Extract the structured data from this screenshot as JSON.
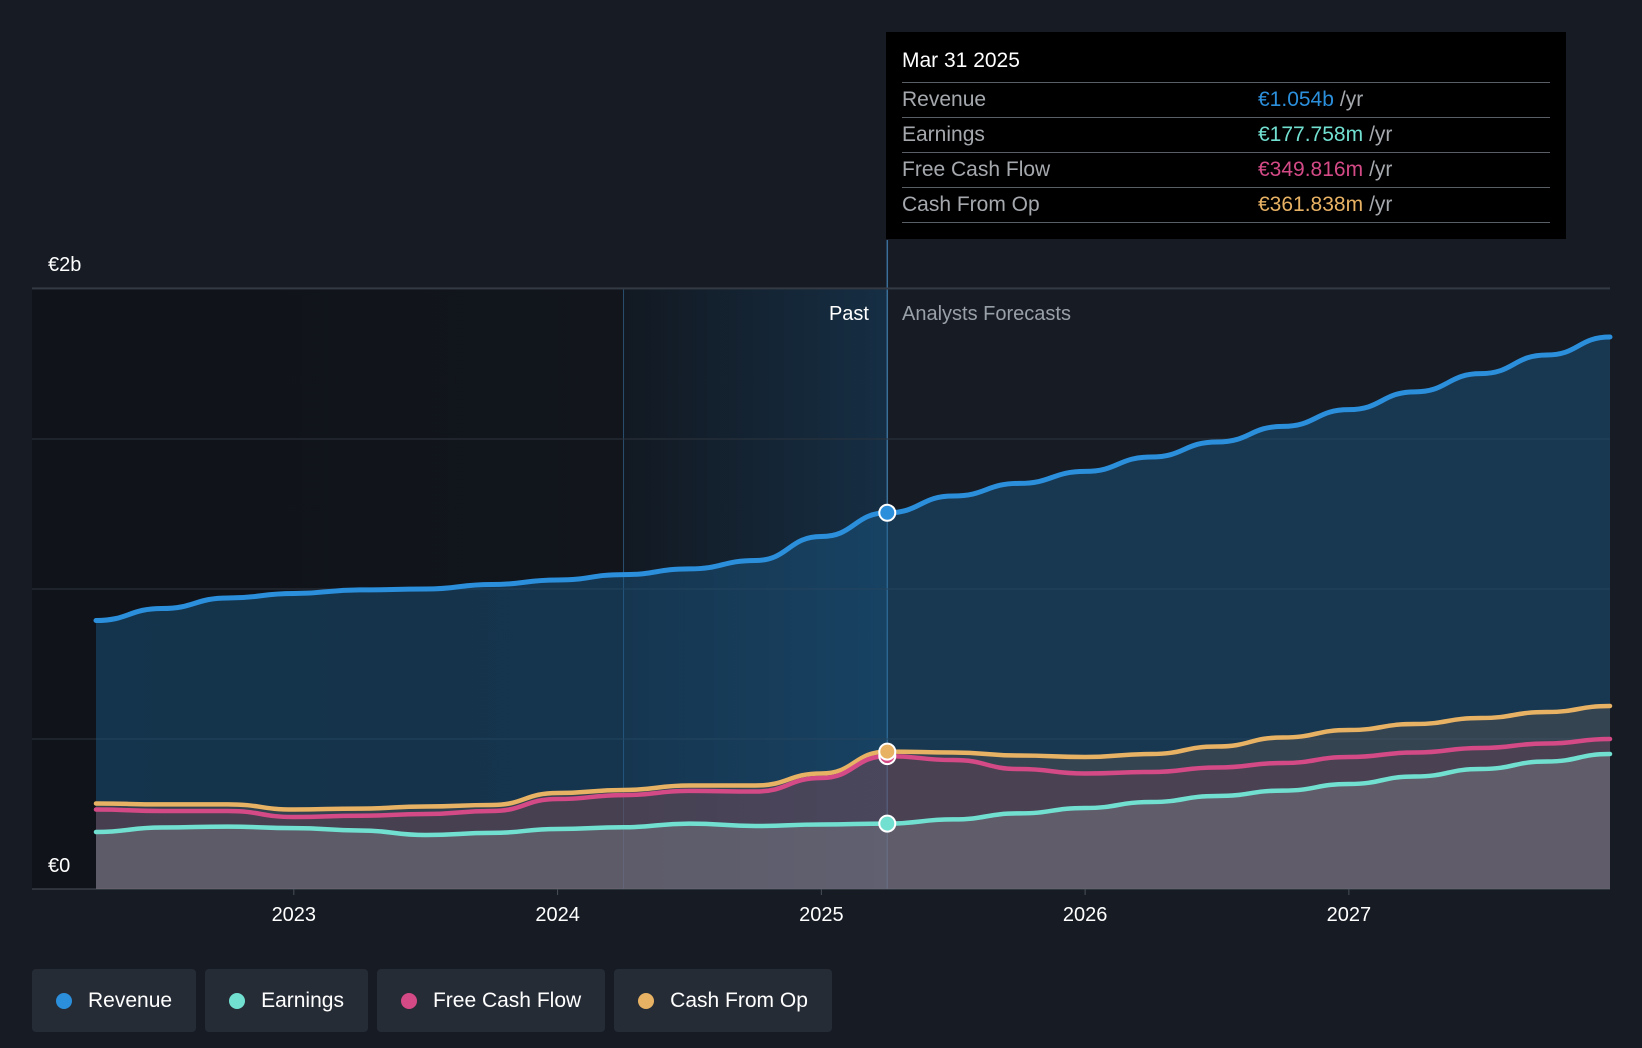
{
  "chart_data": {
    "type": "area",
    "y_axis": {
      "ticks": [
        "€0",
        "€2b"
      ],
      "ylim": [
        0,
        2
      ]
    },
    "x_axis": {
      "ticks": [
        2023,
        2024,
        2025,
        2026,
        2027
      ],
      "xlim": [
        2022.25,
        2027.99
      ]
    },
    "past_label": "Past",
    "forecast_label": "Analysts Forecasts",
    "divider_x": 2025.25,
    "highlight_start_x": 2024.25,
    "grid": true,
    "series": [
      {
        "name": "Revenue",
        "color": "#2b8fdc",
        "points": [
          [
            2022.25,
            0.895
          ],
          [
            2022.5,
            0.935
          ],
          [
            2022.75,
            0.97
          ],
          [
            2023.0,
            0.985
          ],
          [
            2023.25,
            0.997
          ],
          [
            2023.5,
            1.0
          ],
          [
            2023.75,
            1.015
          ],
          [
            2024.0,
            1.03
          ],
          [
            2024.25,
            1.048
          ],
          [
            2024.5,
            1.067
          ],
          [
            2024.75,
            1.095
          ],
          [
            2025.0,
            1.175
          ],
          [
            2025.25,
            1.254
          ],
          [
            2025.5,
            1.31
          ],
          [
            2025.75,
            1.352
          ],
          [
            2026.0,
            1.392
          ],
          [
            2026.25,
            1.44
          ],
          [
            2026.5,
            1.49
          ],
          [
            2026.75,
            1.542
          ],
          [
            2027.0,
            1.598
          ],
          [
            2027.25,
            1.657
          ],
          [
            2027.5,
            1.718
          ],
          [
            2027.75,
            1.78
          ],
          [
            2027.99,
            1.84
          ]
        ]
      },
      {
        "name": "Earnings",
        "color": "#72e0d1",
        "points": [
          [
            2022.25,
            0.19
          ],
          [
            2022.5,
            0.205
          ],
          [
            2022.75,
            0.208
          ],
          [
            2023.0,
            0.203
          ],
          [
            2023.25,
            0.195
          ],
          [
            2023.5,
            0.18
          ],
          [
            2023.75,
            0.187
          ],
          [
            2024.0,
            0.2
          ],
          [
            2024.25,
            0.206
          ],
          [
            2024.5,
            0.218
          ],
          [
            2024.75,
            0.21
          ],
          [
            2025.0,
            0.215
          ],
          [
            2025.25,
            0.218
          ],
          [
            2025.5,
            0.232
          ],
          [
            2025.75,
            0.252
          ],
          [
            2026.0,
            0.27
          ],
          [
            2026.25,
            0.29
          ],
          [
            2026.5,
            0.31
          ],
          [
            2026.75,
            0.328
          ],
          [
            2027.0,
            0.35
          ],
          [
            2027.25,
            0.375
          ],
          [
            2027.5,
            0.4
          ],
          [
            2027.75,
            0.425
          ],
          [
            2027.99,
            0.45
          ]
        ]
      },
      {
        "name": "Free Cash Flow",
        "color": "#d44a86",
        "points": [
          [
            2022.25,
            0.265
          ],
          [
            2022.5,
            0.26
          ],
          [
            2022.75,
            0.26
          ],
          [
            2023.0,
            0.24
          ],
          [
            2023.25,
            0.244
          ],
          [
            2023.5,
            0.25
          ],
          [
            2023.75,
            0.26
          ],
          [
            2024.0,
            0.3
          ],
          [
            2024.25,
            0.313
          ],
          [
            2024.5,
            0.327
          ],
          [
            2024.75,
            0.325
          ],
          [
            2025.0,
            0.37
          ],
          [
            2025.25,
            0.443
          ],
          [
            2025.5,
            0.43
          ],
          [
            2025.75,
            0.4
          ],
          [
            2026.0,
            0.385
          ],
          [
            2026.25,
            0.39
          ],
          [
            2026.5,
            0.405
          ],
          [
            2026.75,
            0.42
          ],
          [
            2027.0,
            0.44
          ],
          [
            2027.25,
            0.455
          ],
          [
            2027.5,
            0.47
          ],
          [
            2027.75,
            0.485
          ],
          [
            2027.99,
            0.5
          ]
        ]
      },
      {
        "name": "Cash From Op",
        "color": "#e8b264",
        "points": [
          [
            2022.25,
            0.285
          ],
          [
            2022.5,
            0.282
          ],
          [
            2022.75,
            0.282
          ],
          [
            2023.0,
            0.265
          ],
          [
            2023.25,
            0.268
          ],
          [
            2023.5,
            0.275
          ],
          [
            2023.75,
            0.28
          ],
          [
            2024.0,
            0.32
          ],
          [
            2024.25,
            0.33
          ],
          [
            2024.5,
            0.345
          ],
          [
            2024.75,
            0.345
          ],
          [
            2025.0,
            0.385
          ],
          [
            2025.25,
            0.458
          ],
          [
            2025.5,
            0.455
          ],
          [
            2025.75,
            0.445
          ],
          [
            2026.0,
            0.44
          ],
          [
            2026.25,
            0.45
          ],
          [
            2026.5,
            0.475
          ],
          [
            2026.75,
            0.505
          ],
          [
            2027.0,
            0.53
          ],
          [
            2027.25,
            0.55
          ],
          [
            2027.5,
            0.57
          ],
          [
            2027.75,
            0.59
          ],
          [
            2027.99,
            0.61
          ]
        ]
      }
    ],
    "markers": [
      {
        "series": "Revenue",
        "x": 2025.25,
        "y": 1.254
      },
      {
        "series": "Free Cash Flow",
        "x": 2025.25,
        "y": 0.443
      },
      {
        "series": "Cash From Op",
        "x": 2025.25,
        "y": 0.458
      },
      {
        "series": "Earnings",
        "x": 2025.25,
        "y": 0.218
      }
    ]
  },
  "tooltip": {
    "title": "Mar 31 2025",
    "rows": [
      {
        "label": "Revenue",
        "value": "€1.054b",
        "unit": "/yr",
        "color": "#2b8fdc"
      },
      {
        "label": "Earnings",
        "value": "€177.758m",
        "unit": "/yr",
        "color": "#72e0d1"
      },
      {
        "label": "Free Cash Flow",
        "value": "€349.816m",
        "unit": "/yr",
        "color": "#d44a86"
      },
      {
        "label": "Cash From Op",
        "value": "€361.838m",
        "unit": "/yr",
        "color": "#e8b264"
      }
    ]
  },
  "legend": {
    "items": [
      {
        "label": "Revenue",
        "color": "#2b8fdc"
      },
      {
        "label": "Earnings",
        "color": "#72e0d1"
      },
      {
        "label": "Free Cash Flow",
        "color": "#d44a86"
      },
      {
        "label": "Cash From Op",
        "color": "#e8b264"
      }
    ]
  }
}
